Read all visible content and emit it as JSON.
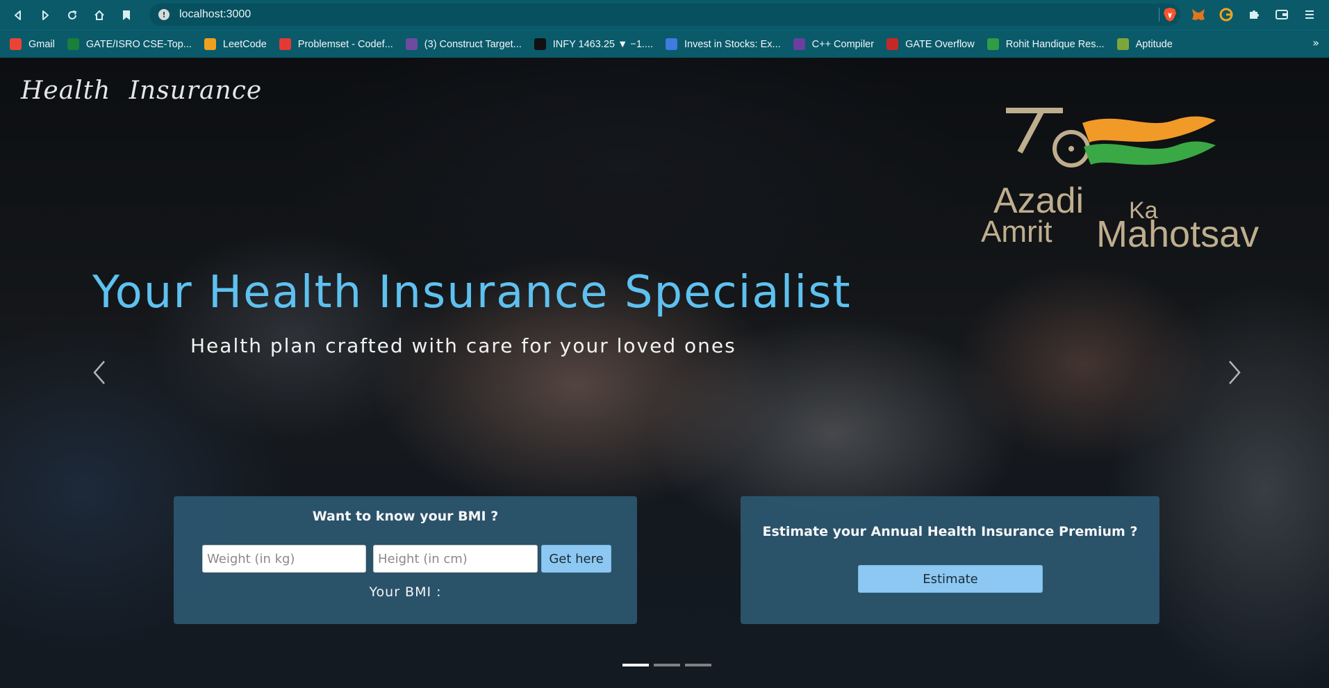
{
  "browser": {
    "url": "localhost:3000",
    "bookmarks": [
      {
        "label": "Gmail",
        "color": "#ea4335"
      },
      {
        "label": "GATE/ISRO CSE-Top...",
        "color": "#1a7f3a"
      },
      {
        "label": "LeetCode",
        "color": "#f0a020"
      },
      {
        "label": "Problemset - Codef...",
        "color": "#e53935"
      },
      {
        "label": "(3) Construct Target...",
        "color": "#6d4c9f"
      },
      {
        "label": "INFY 1463.25 ▼ −1....",
        "color": "#111111"
      },
      {
        "label": "Invest in Stocks: Ex...",
        "color": "#3f7be0"
      },
      {
        "label": "C++ Compiler",
        "color": "#6a3fa0"
      },
      {
        "label": "GATE Overflow",
        "color": "#c62828"
      },
      {
        "label": "Rohit Handique Res...",
        "color": "#2e9d43"
      },
      {
        "label": "Aptitude",
        "color": "#7da63a"
      }
    ]
  },
  "page": {
    "brand": "Health Insurance",
    "logo": {
      "line1": "Azadi",
      "line2": "Ka",
      "line3": "Amrit",
      "line4": "Mahotsav"
    },
    "hero": {
      "title": "Your Health Insurance Specialist",
      "subtitle": "Health plan crafted with care for your loved ones"
    },
    "bmi": {
      "title": "Want to know your BMI ?",
      "weight_placeholder": "Weight (in kg)",
      "height_placeholder": "Height (in cm)",
      "button": "Get here",
      "result_label": "Your BMI :"
    },
    "estimate": {
      "title": "Estimate your Annual Health Insurance Premium ?",
      "button": "Estimate"
    },
    "carousel": {
      "slides": 3,
      "active": 1
    }
  }
}
